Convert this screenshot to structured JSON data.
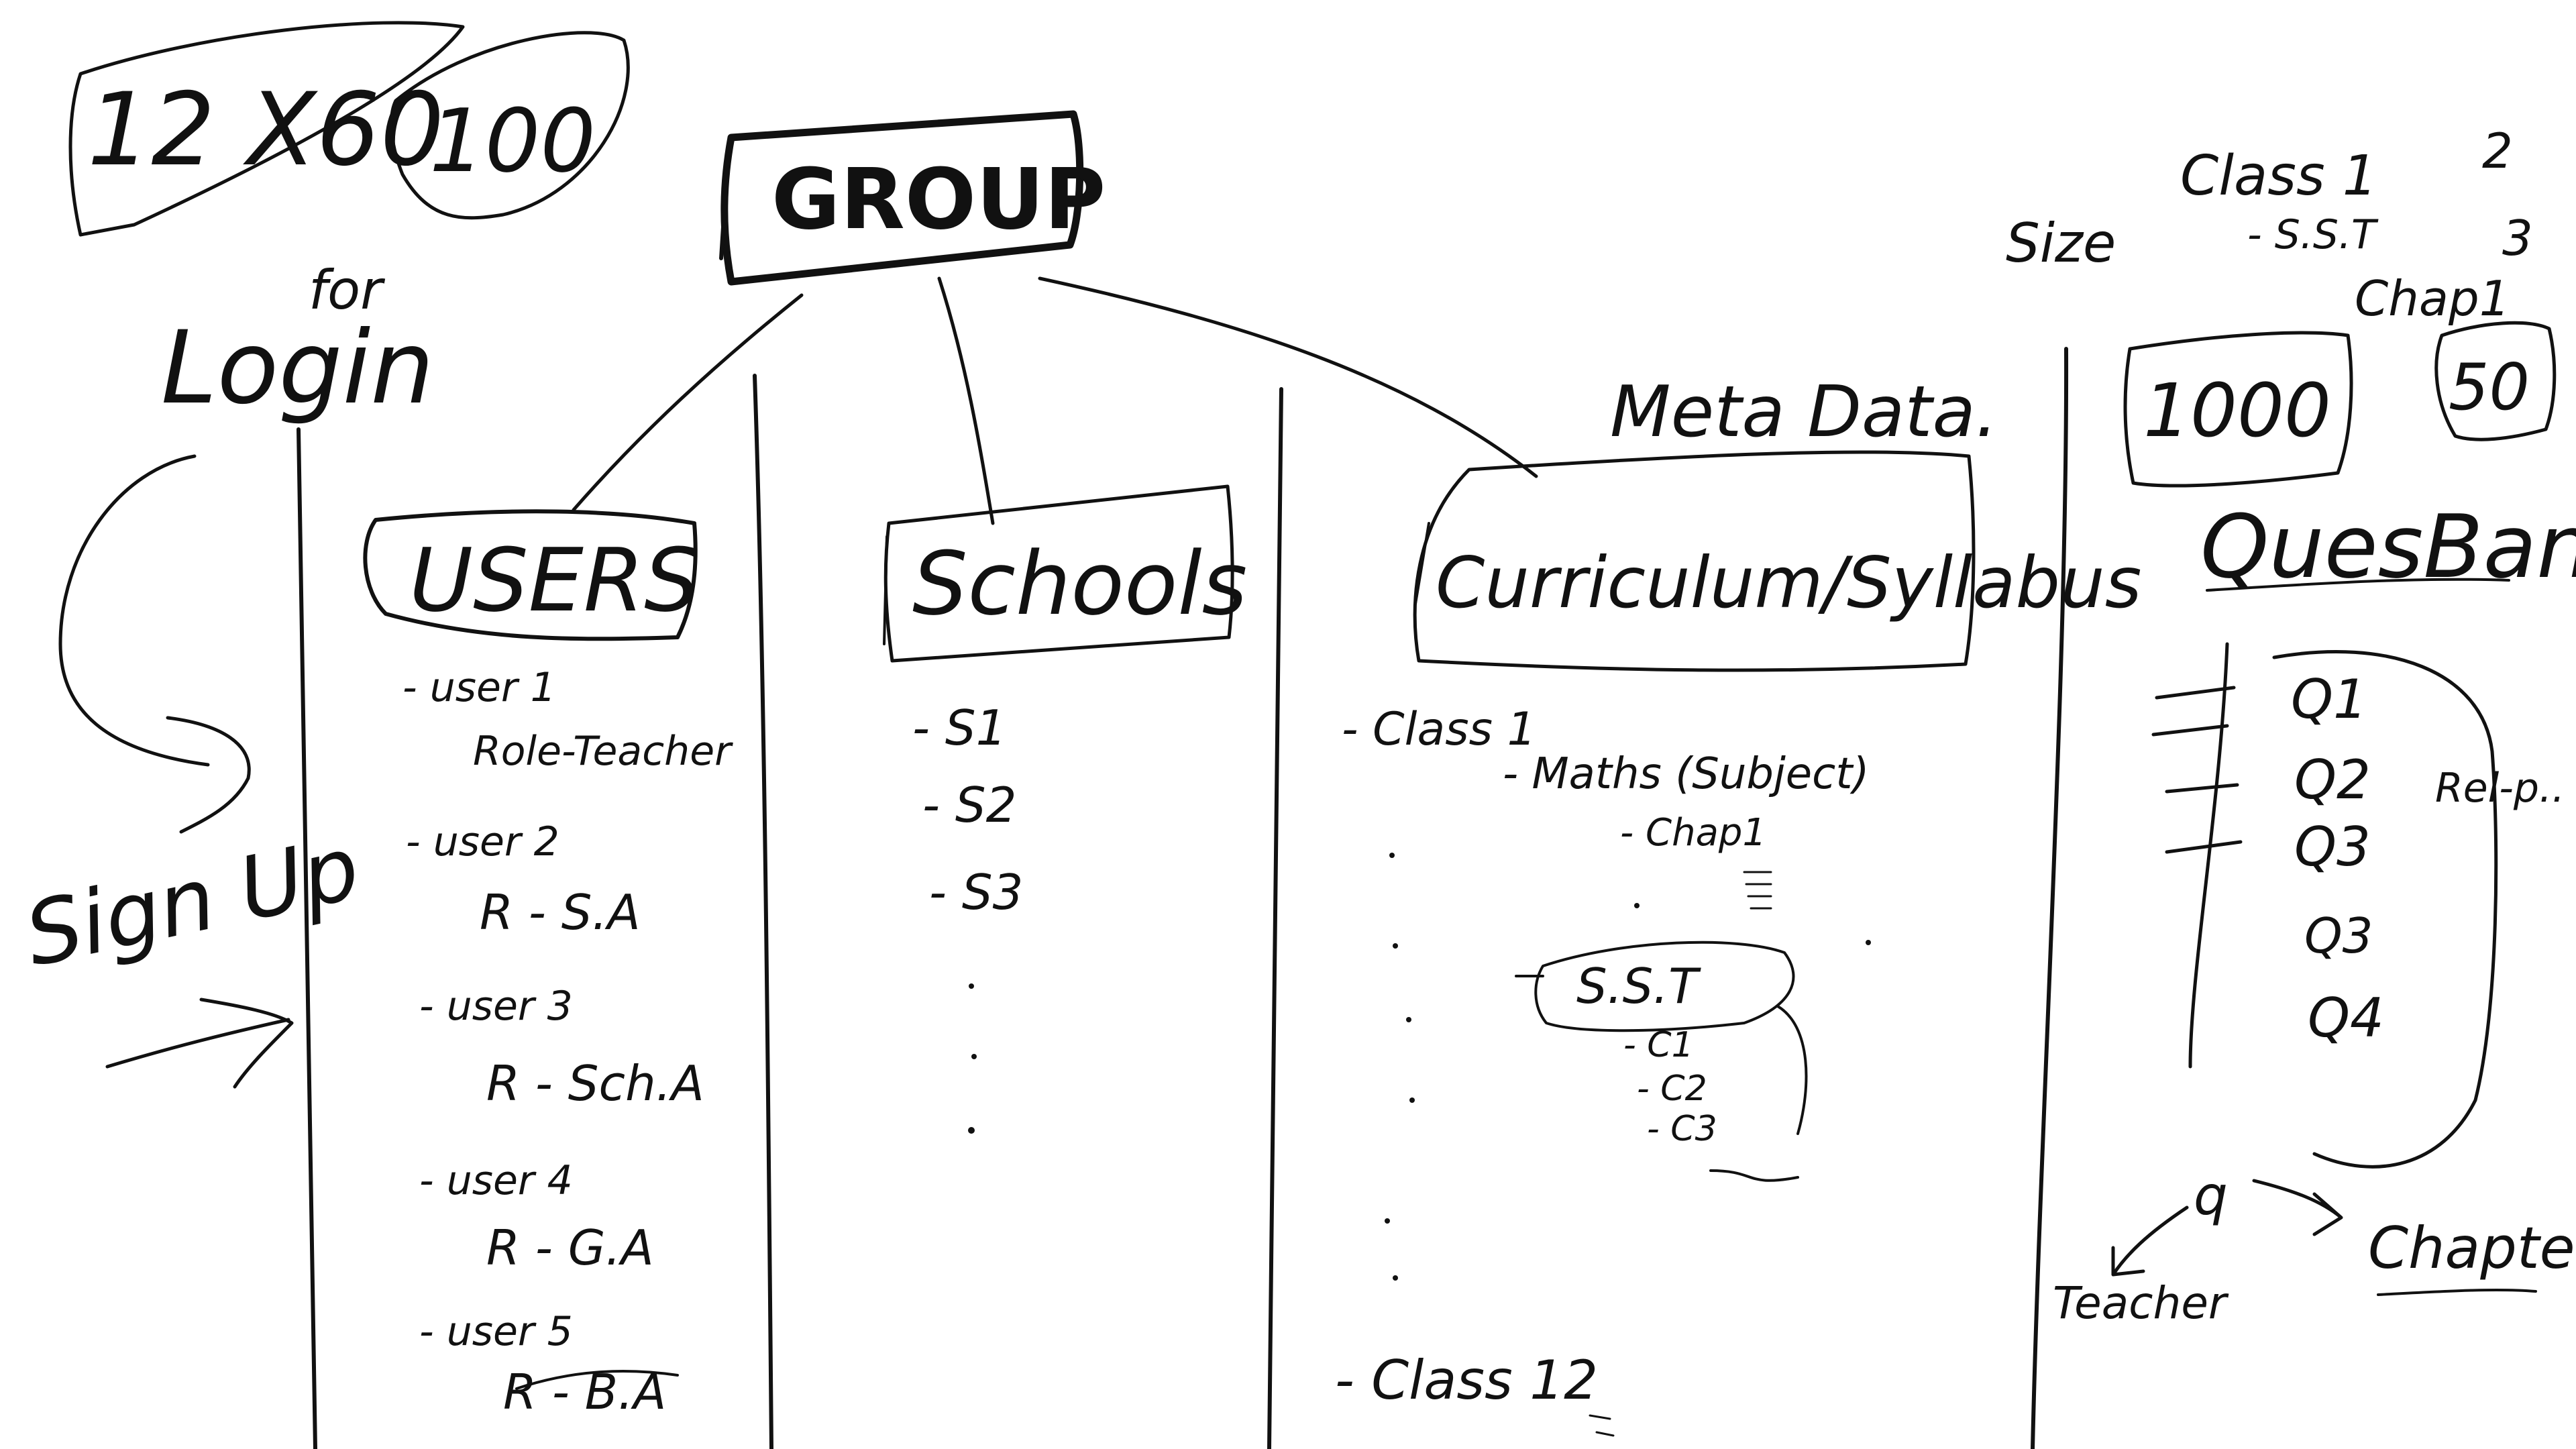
{
  "notes": {
    "count_a": "12 X60",
    "count_b": "100",
    "login": "Login",
    "login_extra": "for",
    "signup": "Sign Up",
    "size": "Size",
    "class1": "Class 1",
    "n2": "2",
    "sst_small": "- S.S.T",
    "n3": "3",
    "chap1_small": "Chap1",
    "count_c": "1000",
    "count_d": "50"
  },
  "root": {
    "label": "GROUP"
  },
  "meta_label": "Meta Data.",
  "columns": {
    "users": {
      "title": "USERS",
      "items": [
        {
          "name": "- user 1",
          "role": "Role-Teacher"
        },
        {
          "name": "- user 2",
          "role": "R - S.A"
        },
        {
          "name": "- user 3",
          "role": "R - Sch.A"
        },
        {
          "name": "- user 4",
          "role": "R - G.A"
        },
        {
          "name": "- user 5",
          "role": "R - B.A"
        }
      ]
    },
    "schools": {
      "title": "Schools",
      "items": [
        "- S1",
        "- S2",
        "- S3"
      ]
    },
    "curriculum": {
      "title": "Curriculum/Syllabus",
      "class_first": "- Class 1",
      "subject": "- Maths (Subject)",
      "chapter": "- Chap1",
      "sst": "S.S.T",
      "sst_items": [
        "- C1",
        "- C2",
        "- C3"
      ],
      "class_last": "- Class 12"
    },
    "quesbank": {
      "title": "QuesBank",
      "items": [
        "Q1",
        "Q2",
        "Q3",
        "Q3",
        "Q4"
      ],
      "side_note": "Rel-p..",
      "left_label": "Teacher",
      "right_label": "Chapter"
    }
  }
}
